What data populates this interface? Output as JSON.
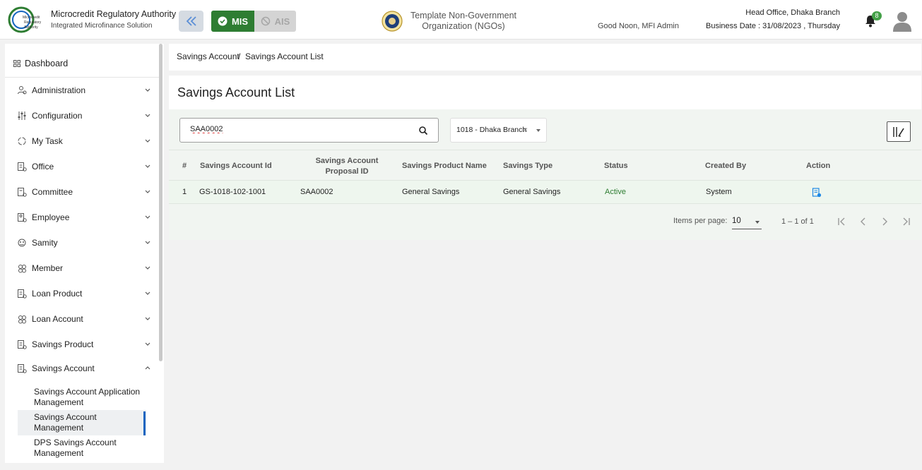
{
  "header": {
    "logo_text": "Microcredit Regulatory Authority",
    "org_name": "Microcredit Regulatory Authority",
    "org_subtitle": "Integrated Microfinance Solution",
    "mis_label": "MIS",
    "ais_label": "AIS",
    "ngo_title": "Template Non-Government Organization (NGOs)",
    "greeting": "Good Noon, MFI Admin",
    "branch": "Head Office, Dhaka Branch",
    "business_date": "Business Date : 31/08/2023 , Thursday",
    "notification_count": "8",
    "accent_color": "#2e7d32"
  },
  "sidebar": {
    "dashboard": "Dashboard",
    "items": [
      {
        "label": "Administration",
        "icon": "admin-icon"
      },
      {
        "label": "Configuration",
        "icon": "config-icon"
      },
      {
        "label": "My Task",
        "icon": "task-icon"
      },
      {
        "label": "Office",
        "icon": "office-icon"
      },
      {
        "label": "Committee",
        "icon": "committee-icon"
      },
      {
        "label": "Employee",
        "icon": "employee-icon"
      },
      {
        "label": "Samity",
        "icon": "samity-icon"
      },
      {
        "label": "Member",
        "icon": "member-icon"
      },
      {
        "label": "Loan Product",
        "icon": "loan-product-icon"
      },
      {
        "label": "Loan Account",
        "icon": "loan-account-icon"
      },
      {
        "label": "Savings Product",
        "icon": "savings-product-icon"
      },
      {
        "label": "Savings Account",
        "icon": "savings-account-icon"
      }
    ],
    "sub_items": [
      {
        "label": "Savings Account Application Management"
      },
      {
        "label": "Savings Account Management"
      },
      {
        "label": "DPS Savings Account Management"
      }
    ]
  },
  "breadcrumb": {
    "parent": "Savings Account",
    "separator": "/",
    "current": "Savings Account List"
  },
  "page": {
    "title": "Savings Account List",
    "search_value": "SAA0002",
    "branch_select": "1018 - Dhaka Branch"
  },
  "table": {
    "headers": [
      "#",
      "Savings Account Id",
      "Savings Account Proposal ID",
      "Savings Product Name",
      "Savings Type",
      "Status",
      "Created By",
      "Action"
    ],
    "rows": [
      {
        "no": "1",
        "account_id": "GS-1018-102-1001",
        "proposal_id": "SAA0002",
        "product_name": "General Savings",
        "savings_type": "General Savings",
        "status": "Active",
        "created_by": "System"
      }
    ],
    "status_color": "#2e7d32"
  },
  "pagination": {
    "items_per_page_label": "Items per page:",
    "items_per_page": "10",
    "range": "1 – 1 of 1"
  }
}
